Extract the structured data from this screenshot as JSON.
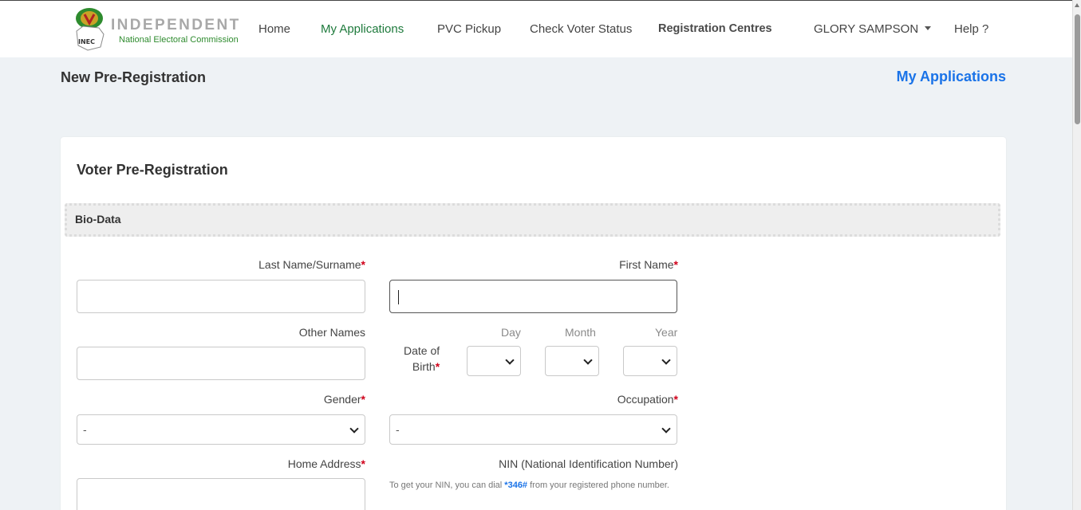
{
  "nav": {
    "logo_title": "INDEPENDENT",
    "logo_subtitle": "National Electoral Commission",
    "logo_badge": "INEC",
    "links": [
      "Home",
      "My Applications",
      "PVC Pickup",
      "Check Voter Status",
      "Registration Centres"
    ],
    "user": "GLORY SAMPSON",
    "help": "Help ?"
  },
  "page": {
    "title": "New Pre-Registration",
    "link": "My Applications"
  },
  "form": {
    "title": "Voter Pre-Registration",
    "section": "Bio-Data",
    "required_mark": "*",
    "last_name_label": "Last Name/Surname",
    "first_name_label": "First Name",
    "other_names_label": "Other Names",
    "dob_label_line1": "Date of",
    "dob_label_line2": "Birth",
    "day_label": "Day",
    "month_label": "Month",
    "year_label": "Year",
    "gender_label": "Gender",
    "gender_value": "-",
    "occupation_label": "Occupation",
    "occupation_value": "-",
    "address_label": "Home Address",
    "nin_label": "NIN (National Identification Number)",
    "nin_help_prefix": "To get your NIN, you can dial ",
    "nin_help_code": "*346#",
    "nin_help_suffix": " from your registered phone number."
  },
  "colors": {
    "accent_green": "#1e7a3c",
    "link_blue": "#1a73e8",
    "required_red": "#d0021b"
  }
}
